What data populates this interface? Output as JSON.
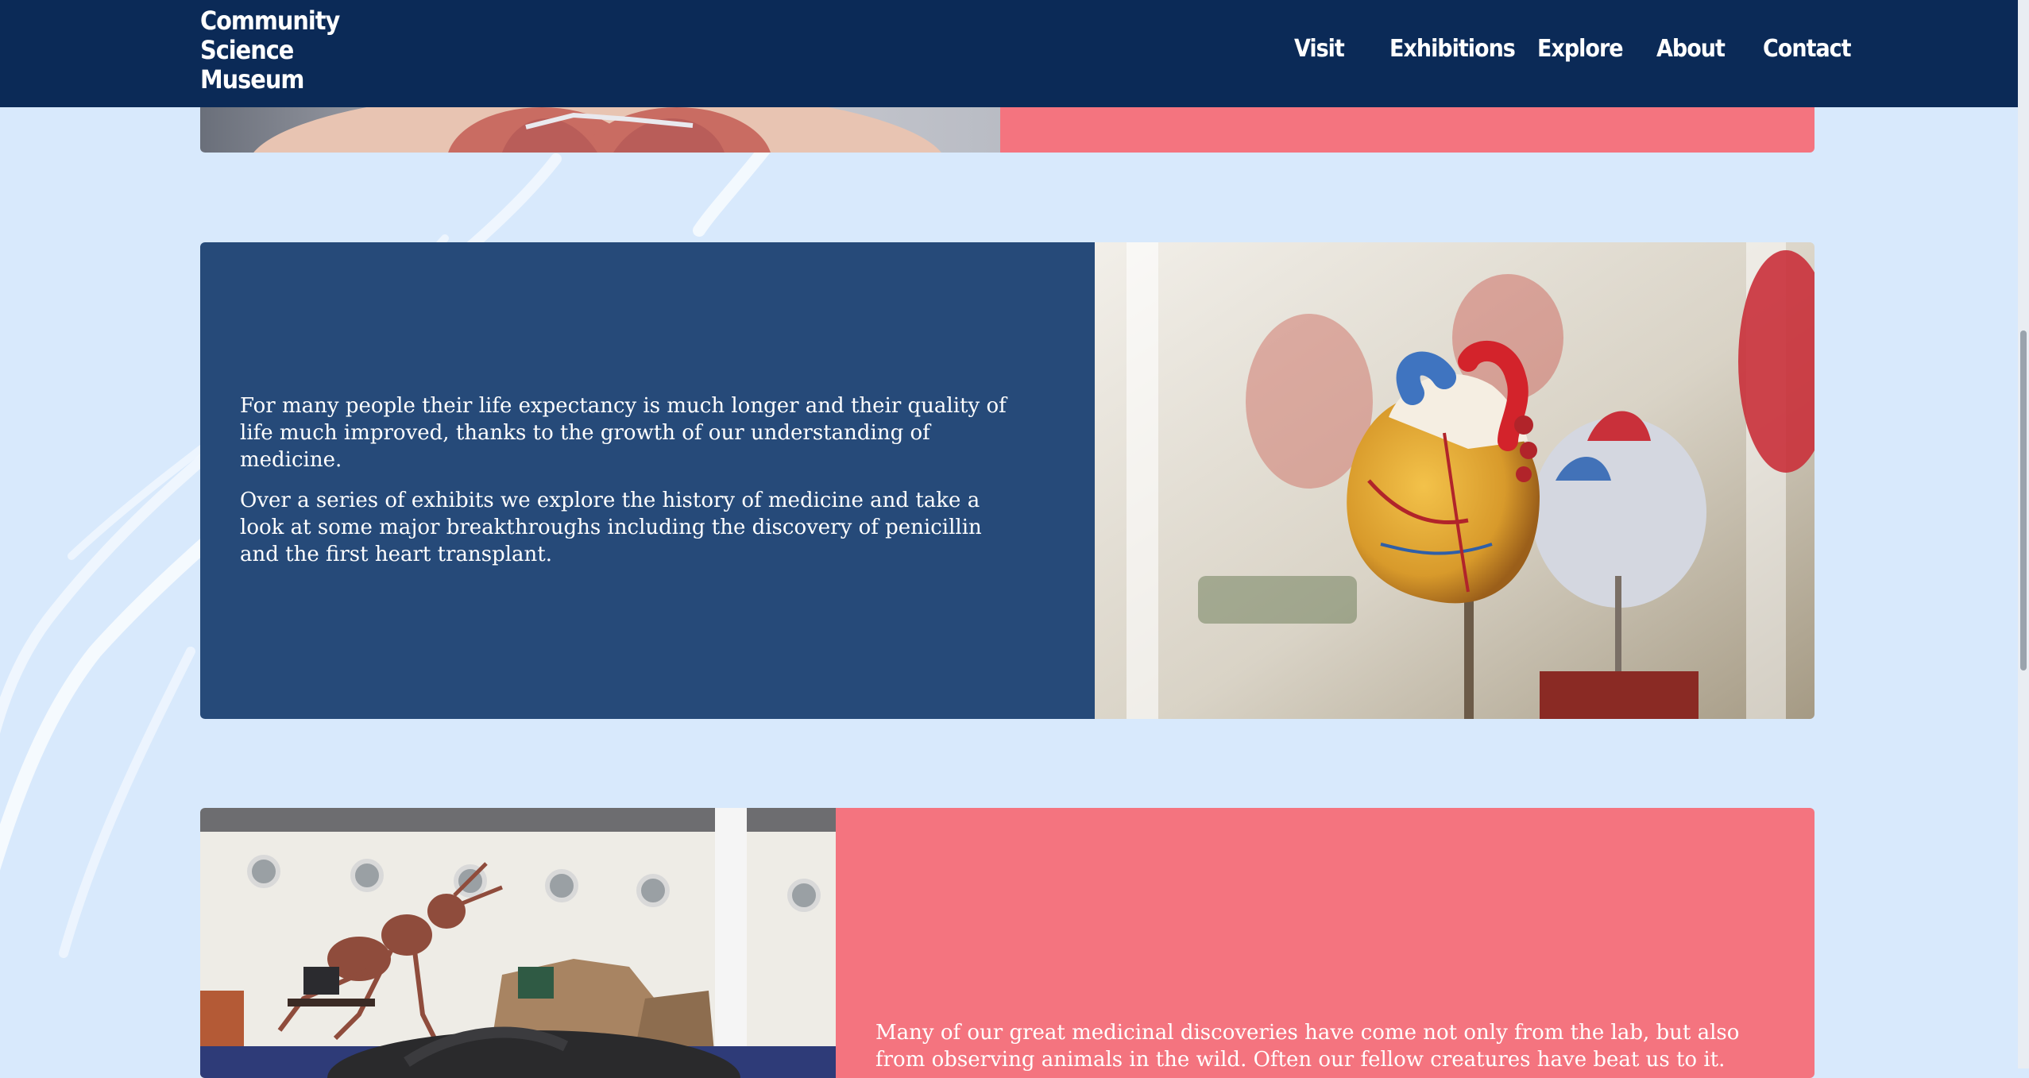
{
  "site": {
    "logo_lines": [
      "Community",
      "Science",
      "Museum"
    ]
  },
  "nav": {
    "items": [
      {
        "label": "Visit"
      },
      {
        "label": "Exhibitions"
      },
      {
        "label": "Explore"
      },
      {
        "label": "About"
      },
      {
        "label": "Contact"
      }
    ]
  },
  "sections": {
    "top_card": {
      "image_icon": "anatomy-model-photo",
      "panel_color": "#f4747f"
    },
    "medicine_card": {
      "paragraphs": [
        "For many people their life expectancy is much longer and their quality of life much improved, thanks to the growth of our understanding of medicine.",
        "Over a series of exhibits we explore the history of medicine and take a look at some major breakthroughs including the discovery of penicillin and the first heart transplant."
      ],
      "image_icon": "heart-model-photo",
      "panel_color": "#264a79"
    },
    "animals_card": {
      "paragraphs": [
        "Many of our great medicinal discoveries have come not only from the lab, but also from observing animals in the wild. Often our fellow creatures have beat us to it."
      ],
      "image_icon": "ant-exhibit-photo",
      "panel_color": "#f4747f"
    }
  },
  "colors": {
    "header": "#0b2a57",
    "page_background": "#d8e9fc",
    "coral": "#f4747f",
    "navy_panel": "#264a79"
  }
}
